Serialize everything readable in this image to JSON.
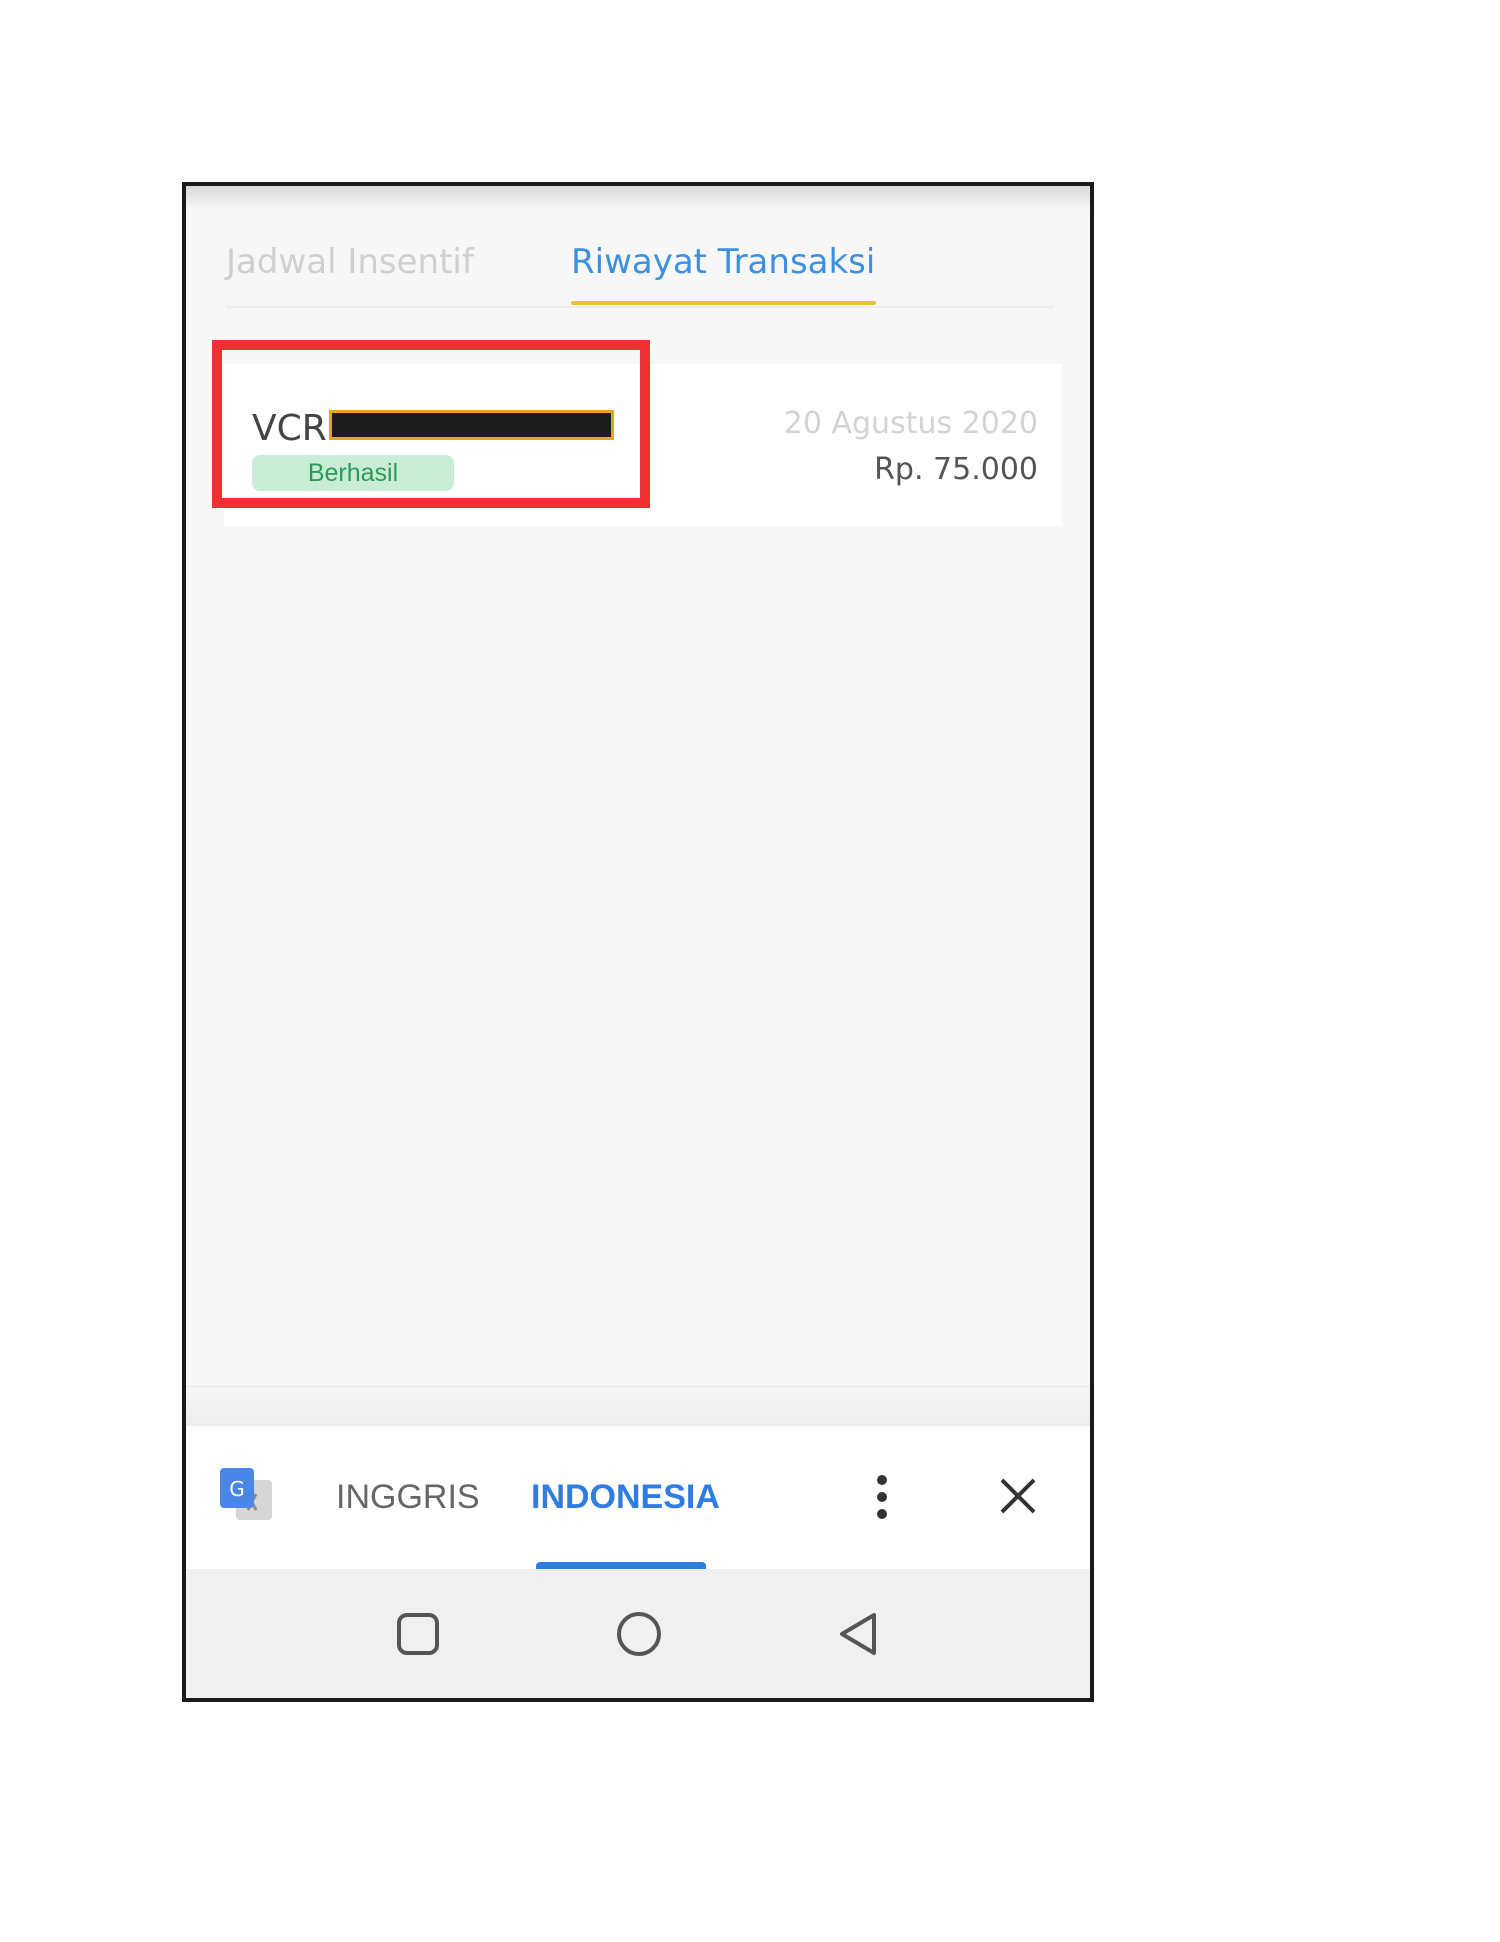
{
  "tabs": {
    "inactive_label": "Jadwal Insentif",
    "active_label": "Riwayat Transaksi",
    "active_color": "#3d8fe0",
    "underline_color": "#f2c02f"
  },
  "transaction": {
    "id_prefix": "VCR",
    "status": "Berhasil",
    "date": "20 Agustus 2020",
    "amount": "Rp. 75.000"
  },
  "translate_bar": {
    "source_language": "INGGRIS",
    "target_language": "INDONESIA",
    "icons": [
      "google-translate-icon",
      "more-vert-icon",
      "close-icon"
    ]
  },
  "system_nav": {
    "icons": [
      "recent-apps-icon",
      "home-icon",
      "back-icon"
    ]
  },
  "highlight_color": "#ef2f34"
}
